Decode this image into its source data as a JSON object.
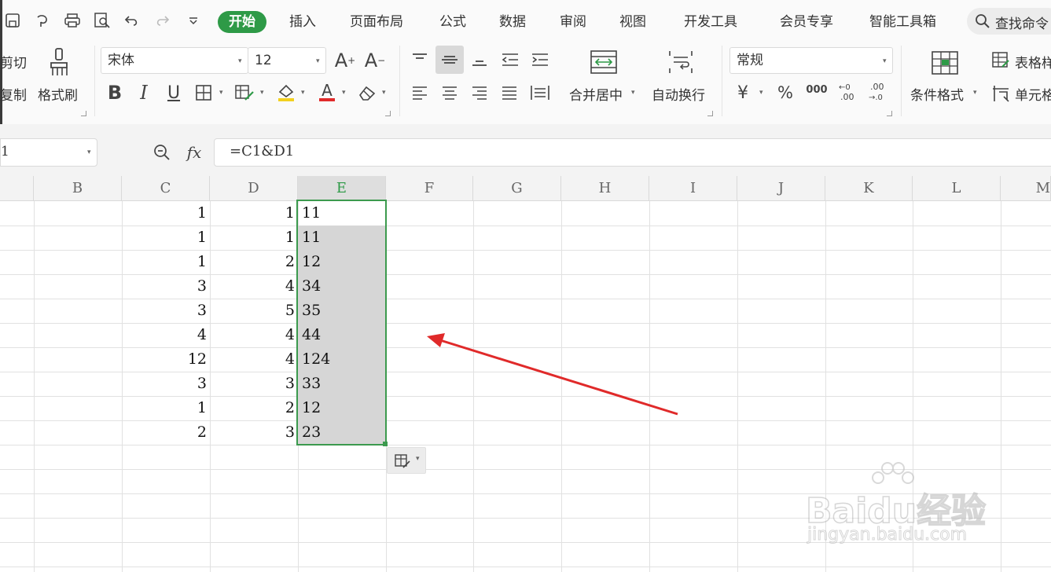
{
  "tabs": [
    "开始",
    "插入",
    "页面布局",
    "公式",
    "数据",
    "审阅",
    "视图",
    "开发工具",
    "会员专享",
    "智能工具箱"
  ],
  "search_label": "查找命令",
  "clipboard": {
    "cut": "剪切",
    "copy": "复制",
    "format_painter": "格式刷"
  },
  "font": {
    "name": "宋体",
    "size": "12"
  },
  "alignment": {
    "merge_center": "合并居中",
    "wrap_text": "自动换行"
  },
  "number": {
    "format": "常规",
    "currency": "¥",
    "percent": "%",
    "thousands": "000"
  },
  "styles": {
    "conditional_format": "条件格式",
    "table_style": "表格样式",
    "cell_style": "单元格"
  },
  "formula_bar": {
    "name_box": "1",
    "fx": "fx",
    "formula": "=C1&D1"
  },
  "columns": [
    "B",
    "C",
    "D",
    "E",
    "F",
    "G",
    "H",
    "I",
    "J",
    "K",
    "L",
    "M"
  ],
  "selected_column": "E",
  "rows": [
    {
      "c": "1",
      "d": "1",
      "e": "11"
    },
    {
      "c": "1",
      "d": "1",
      "e": "11"
    },
    {
      "c": "1",
      "d": "2",
      "e": "12"
    },
    {
      "c": "3",
      "d": "4",
      "e": "34"
    },
    {
      "c": "3",
      "d": "5",
      "e": "35"
    },
    {
      "c": "4",
      "d": "4",
      "e": "44"
    },
    {
      "c": "12",
      "d": "4",
      "e": "124"
    },
    {
      "c": "3",
      "d": "3",
      "e": "33"
    },
    {
      "c": "1",
      "d": "2",
      "e": "12"
    },
    {
      "c": "2",
      "d": "3",
      "e": "23"
    }
  ],
  "watermark": {
    "brand": "Baidu经验",
    "url": "jingyan.baidu.com"
  },
  "colors": {
    "accent": "#2e9a47",
    "selection_fill": "#d6d6d6",
    "arrow": "#e02a2a"
  }
}
